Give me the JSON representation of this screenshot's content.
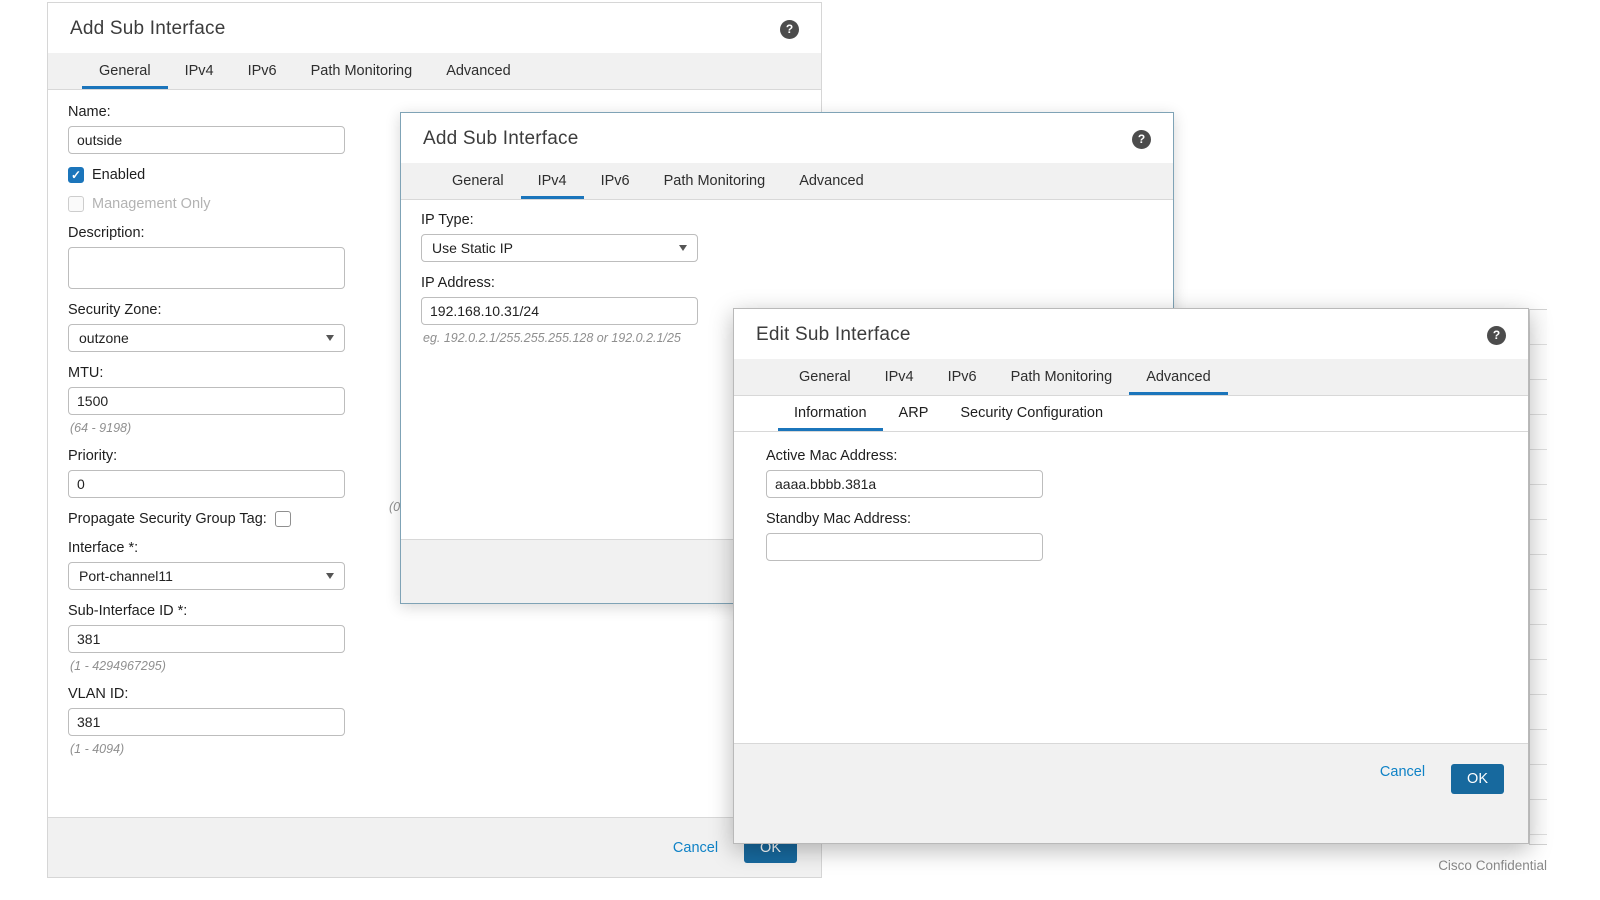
{
  "colors": {
    "accent_underline": "#1b75bb",
    "ok_button": "#17699e",
    "cancel_link": "#0f82c6",
    "checked_checkbox": "#1b75bb"
  },
  "page": {
    "confidential_note": "Cisco Confidential"
  },
  "dialog_add_general": {
    "title": "Add Sub Interface",
    "help_icon": "?",
    "check_glyph": "✓",
    "tabs": [
      {
        "label": "General"
      },
      {
        "label": "IPv4"
      },
      {
        "label": "IPv6"
      },
      {
        "label": "Path Monitoring"
      },
      {
        "label": "Advanced"
      }
    ],
    "name_label": "Name:",
    "name_value": "outside",
    "enabled_label": "Enabled",
    "management_only_label": "Management Only",
    "description_label": "Description:",
    "description_value": "",
    "security_zone_label": "Security Zone:",
    "security_zone_value": "outzone",
    "mtu_label": "MTU:",
    "mtu_value": "1500",
    "mtu_hint": "(64 - 9198)",
    "priority_label": "Priority:",
    "priority_value": "0",
    "priority_hint_partial": "(0",
    "propagate_label": "Propagate Security Group Tag:",
    "interface_label": "Interface *:",
    "interface_value": "Port-channel11",
    "sub_interface_id_label": "Sub-Interface ID *:",
    "sub_interface_id_value": "381",
    "sub_interface_id_hint": "(1 - 4294967295)",
    "vlan_id_label": "VLAN ID:",
    "vlan_id_value": "381",
    "vlan_id_hint": "(1 - 4094)",
    "cancel_label": "Cancel",
    "ok_label": "OK"
  },
  "dialog_add_ipv4": {
    "title": "Add Sub Interface",
    "help_icon": "?",
    "tabs": [
      {
        "label": "General"
      },
      {
        "label": "IPv4"
      },
      {
        "label": "IPv6"
      },
      {
        "label": "Path Monitoring"
      },
      {
        "label": "Advanced"
      }
    ],
    "ip_type_label": "IP Type:",
    "ip_type_value": "Use Static IP",
    "ip_address_label": "IP Address:",
    "ip_address_value": "192.168.10.31/24",
    "ip_address_hint": "eg. 192.0.2.1/255.255.255.128 or 192.0.2.1/25"
  },
  "dialog_edit_advanced": {
    "title": "Edit Sub Interface",
    "help_icon": "?",
    "tabs": [
      {
        "label": "General"
      },
      {
        "label": "IPv4"
      },
      {
        "label": "IPv6"
      },
      {
        "label": "Path Monitoring"
      },
      {
        "label": "Advanced"
      }
    ],
    "subtabs": [
      {
        "label": "Information"
      },
      {
        "label": "ARP"
      },
      {
        "label": "Security Configuration"
      }
    ],
    "active_mac_label": "Active Mac Address:",
    "active_mac_value": "aaaa.bbbb.381a",
    "standby_mac_label": "Standby Mac Address:",
    "standby_mac_value": "",
    "cancel_label": "Cancel",
    "ok_label": "OK"
  }
}
